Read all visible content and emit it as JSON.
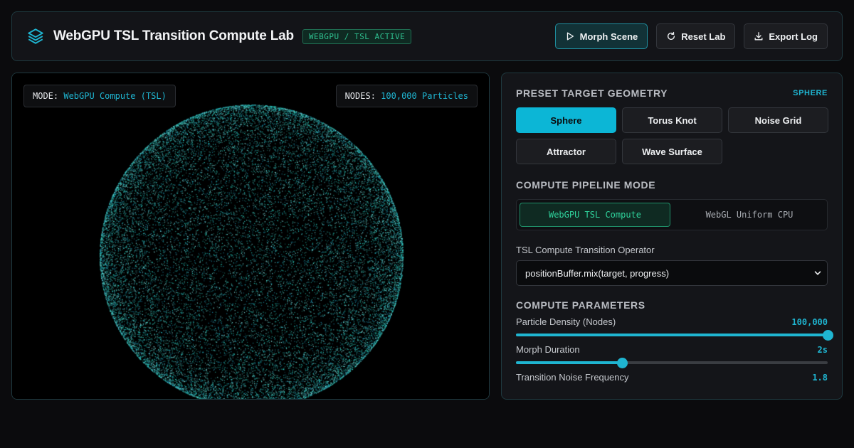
{
  "app": {
    "title": "WebGPU TSL Transition Compute Lab",
    "status_badge": "WEBGPU / TSL ACTIVE"
  },
  "actions": {
    "morph": "Morph Scene",
    "reset": "Reset Lab",
    "export": "Export Log"
  },
  "viewport": {
    "mode_key": "MODE:",
    "mode_value": "WebGPU Compute (TSL)",
    "nodes_key": "NODES:",
    "nodes_value": "100,000 Particles"
  },
  "geometry": {
    "title": "PRESET TARGET GEOMETRY",
    "current": "SPHERE",
    "options": [
      "Sphere",
      "Torus Knot",
      "Noise Grid",
      "Attractor",
      "Wave Surface"
    ],
    "selected_index": 0
  },
  "pipeline": {
    "title": "COMPUTE PIPELINE MODE",
    "options": [
      "WebGPU TSL Compute",
      "WebGL Uniform CPU"
    ],
    "selected_index": 0
  },
  "operator": {
    "label": "TSL Compute Transition Operator",
    "value": "positionBuffer.mix(target, progress)"
  },
  "params": {
    "title": "COMPUTE PARAMETERS",
    "density": {
      "label": "Particle Density (Nodes)",
      "value_text": "100,000",
      "level": 1.0
    },
    "duration": {
      "label": "Morph Duration",
      "value_text": "2s",
      "level": 0.34
    },
    "noise": {
      "label": "Transition Noise Frequency",
      "value_text": "1.8"
    }
  },
  "colors": {
    "accent": "#0cb6d6",
    "active_green": "#2fd39c",
    "particle_a": "#2ad0c0",
    "particle_b": "#1a8fb0"
  }
}
